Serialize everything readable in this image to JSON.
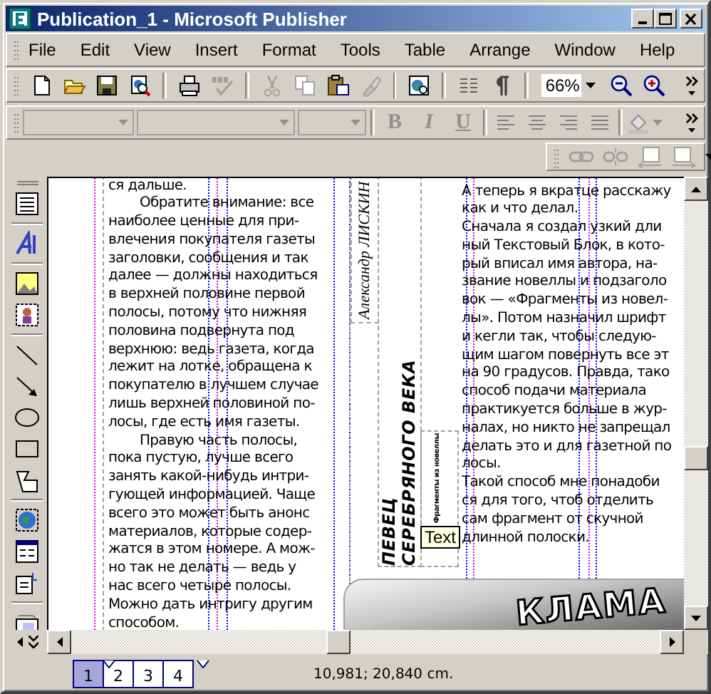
{
  "window": {
    "title": "Publication_1 - Microsoft Publisher"
  },
  "menu": [
    {
      "label": "File"
    },
    {
      "label": "Edit"
    },
    {
      "label": "View"
    },
    {
      "label": "Insert"
    },
    {
      "label": "Format"
    },
    {
      "label": "Tools"
    },
    {
      "label": "Table"
    },
    {
      "label": "Arrange"
    },
    {
      "label": "Window"
    },
    {
      "label": "Help"
    }
  ],
  "standard_toolbar": {
    "zoom": "66%"
  },
  "formatting_toolbar": {
    "fields": [
      {
        "disabled": true
      },
      {
        "disabled": true
      },
      {
        "disabled": true
      }
    ],
    "style_buttons": [
      {
        "label": "B",
        "kind": "bold",
        "disabled": true
      },
      {
        "label": "I",
        "kind": "italic",
        "disabled": true
      },
      {
        "label": "U",
        "kind": "underline",
        "disabled": true
      }
    ]
  },
  "document": {
    "left_column": [
      {
        "indent": false,
        "lines": [
          "ся дальше."
        ]
      },
      {
        "indent": true,
        "lines": [
          "Обратите внимание: все",
          "наиболее ценные для при-",
          "влечения покупателя газеты",
          "заголовки, сообщения и так",
          "далее — должны находиться",
          "в верхней половине первой",
          "полосы, потому что нижняя",
          "половина подвернута под",
          "верхнюю: ведь газета, когда",
          "лежит на лотке, обращена к",
          "покупателю в лучшем случае",
          "лишь верхней половиной по-",
          "лосы, где есть имя газеты."
        ]
      },
      {
        "indent": true,
        "lines": [
          "Правую часть полосы,",
          "пока пустую, лучше всего",
          "занять какой-нибудь интри-",
          "гующей информацией. Чаще",
          "всего это может быть анонс",
          "материалов, которые содер-",
          "жатся в этом номере. А мож-",
          "но так не делать — ведь у",
          "нас всего четыре полосы.",
          "Можно дать интригу другим",
          "способом."
        ]
      }
    ],
    "author": "Александр ЛИСКИН",
    "headline": [
      "ПЕВЕЦ",
      "СЕРЕБРЯНОГО ВЕКА"
    ],
    "subtitle": "Фрагменты из новеллы",
    "right_column": [
      {
        "indent": false,
        "lines": [
          "А теперь я вкратце расскажу",
          "как и что делал."
        ]
      },
      {
        "indent": false,
        "lines": [
          "Сначала я создал узкий дли",
          "ный Текстовый Блок, в кото-",
          "рый вписал имя автора, на-",
          "звание новеллы и подзаголо",
          "вок — «Фрагменты из новел-",
          "лы». Потом назначил шрифт",
          "и кегли так, чтобы следую-",
          "щим шагом повернуть все эт",
          "на 90 градусов. Правда, тако",
          "способ подачи материала",
          "практикуется больше в жур-",
          "налах, но никто не запрещал",
          "делать это и для газетной по",
          "лосы."
        ]
      },
      {
        "indent": false,
        "lines": [
          "Такой способ мне понадоби",
          "ся для того, чтоб отделить",
          "сам фрагмент от скучной",
          "длинной полоски."
        ]
      }
    ],
    "banner_text": "КЛАМА"
  },
  "tooltip": "Text",
  "pages": [
    {
      "label": "1",
      "selected": true
    },
    {
      "label": "2",
      "selected": false
    },
    {
      "label": "3",
      "selected": false
    },
    {
      "label": "4",
      "selected": false
    }
  ],
  "status_bar": {
    "position": "10,981; 20,840 cm."
  }
}
